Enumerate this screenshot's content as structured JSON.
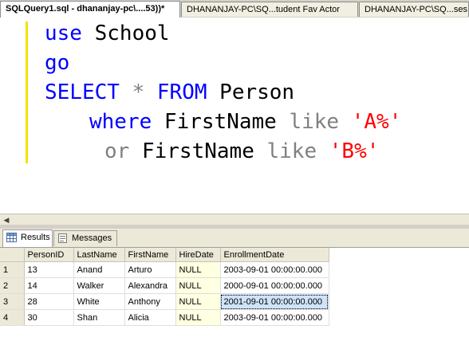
{
  "tabs": [
    {
      "label": "SQLQuery1.sql - dhananjay-pc\\....53))*",
      "active": true
    },
    {
      "label": "DHANANJAY-PC\\SQ...tudent Fav Actor",
      "active": false
    },
    {
      "label": "DHANANJAY-PC\\SQ...ses",
      "active": false
    }
  ],
  "editor": {
    "line1": {
      "kw": "use",
      "text": " School"
    },
    "line2": {
      "kw": "go"
    },
    "line3": {
      "kw1": "SELECT",
      "star": " * ",
      "kw2": "FROM",
      "text": " Person"
    },
    "line4": {
      "kw": "where",
      "text": " FirstName ",
      "op": "like",
      "space": " ",
      "str": "'A%'"
    },
    "line5": {
      "op1": "or",
      "text": " FirstName ",
      "op2": "like",
      "space": " ",
      "str": "'B%'"
    }
  },
  "results_tabs": {
    "results_label": "Results",
    "messages_label": "Messages"
  },
  "grid": {
    "columns": [
      "",
      "PersonID",
      "LastName",
      "FirstName",
      "HireDate",
      "EnrollmentDate"
    ],
    "rows": [
      {
        "rownum": "1",
        "PersonID": "13",
        "LastName": "Anand",
        "FirstName": "Arturo",
        "HireDate": "NULL",
        "EnrollmentDate": "2003-09-01 00:00:00.000"
      },
      {
        "rownum": "2",
        "PersonID": "14",
        "LastName": "Walker",
        "FirstName": "Alexandra",
        "HireDate": "NULL",
        "EnrollmentDate": "2000-09-01 00:00:00.000"
      },
      {
        "rownum": "3",
        "PersonID": "28",
        "LastName": "White",
        "FirstName": "Anthony",
        "HireDate": "NULL",
        "EnrollmentDate": "2001-09-01 00:00:00.000"
      },
      {
        "rownum": "4",
        "PersonID": "30",
        "LastName": "Shan",
        "FirstName": "Alicia",
        "HireDate": "NULL",
        "EnrollmentDate": "2003-09-01 00:00:00.000"
      }
    ],
    "selected_cell": {
      "row": 3,
      "column": "EnrollmentDate"
    }
  },
  "colors": {
    "keyword": "#0000ff",
    "operator": "#808080",
    "string": "#ff0000",
    "null_cell": "#ffffe1",
    "selected_cell": "#cfe3f9"
  }
}
